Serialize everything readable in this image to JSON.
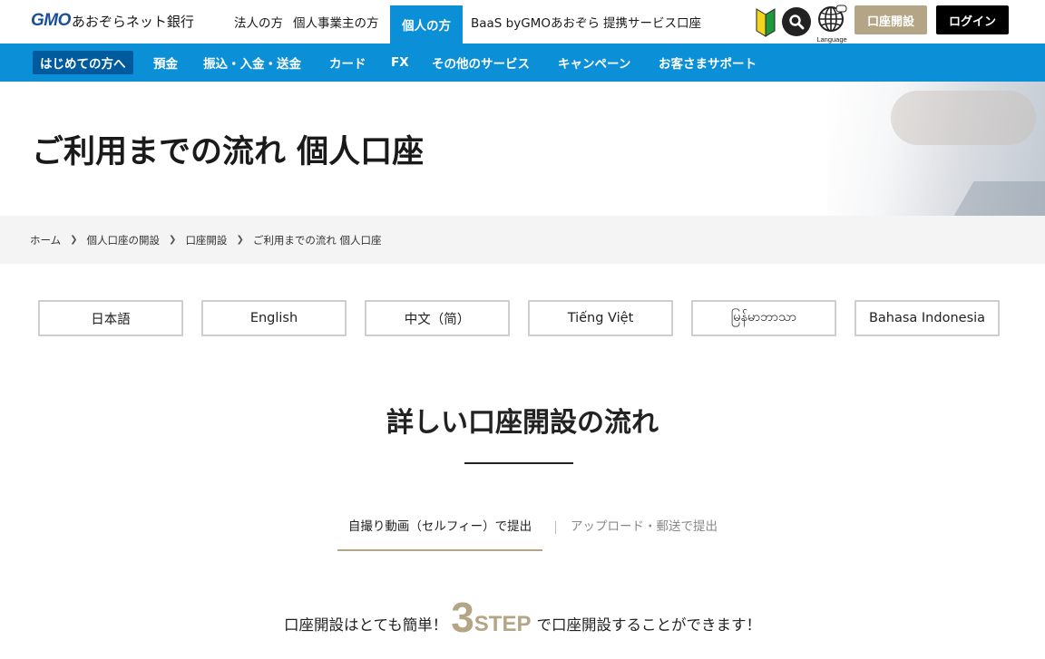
{
  "header": {
    "logo_gmo": "GMO",
    "logo_bank": "あおぞらネット銀行",
    "nav": [
      {
        "label": "法人の方"
      },
      {
        "label": "個人事業主の方"
      },
      {
        "label": "個人の方"
      },
      {
        "label": "BaaS byGMOあおぞら"
      },
      {
        "label": "提携サービス口座"
      }
    ],
    "language_label": "Language",
    "open_account": "口座開設",
    "login": "ログイン"
  },
  "main_nav": [
    {
      "label": "はじめての方へ"
    },
    {
      "label": "預金"
    },
    {
      "label": "振込・入金・送金"
    },
    {
      "label": "カード"
    },
    {
      "label": "FX"
    },
    {
      "label": "その他のサービス"
    },
    {
      "label": "キャンペーン"
    },
    {
      "label": "お客さまサポート"
    }
  ],
  "page_title": "ご利用までの流れ 個人口座",
  "breadcrumb": [
    "ホーム",
    "個人口座の開設",
    "口座開設",
    "ご利用までの流れ 個人口座"
  ],
  "languages": [
    "日本語",
    "English",
    "中文（简）",
    "Tiếng Việt",
    "မြန်မာဘာသာ",
    "Bahasa Indonesia"
  ],
  "section": {
    "title": "詳しい口座開設の流れ",
    "tabs": [
      {
        "label": "自撮り動画（セルフィー）で提出",
        "active": true
      },
      {
        "label": "アップロード・郵送で提出",
        "active": false
      }
    ],
    "steps": {
      "before": "口座開設はとても簡単！",
      "number": "3",
      "word": "STEP",
      "after": "で口座開設することができます！"
    }
  },
  "colors": {
    "brand_blue": "#0b8fd6",
    "gold": "#b3a585",
    "logo_blue": "#1a4f99"
  },
  "icons": {
    "beginner": "beginner-mark-icon",
    "search": "search-icon",
    "language": "globe-icon"
  }
}
